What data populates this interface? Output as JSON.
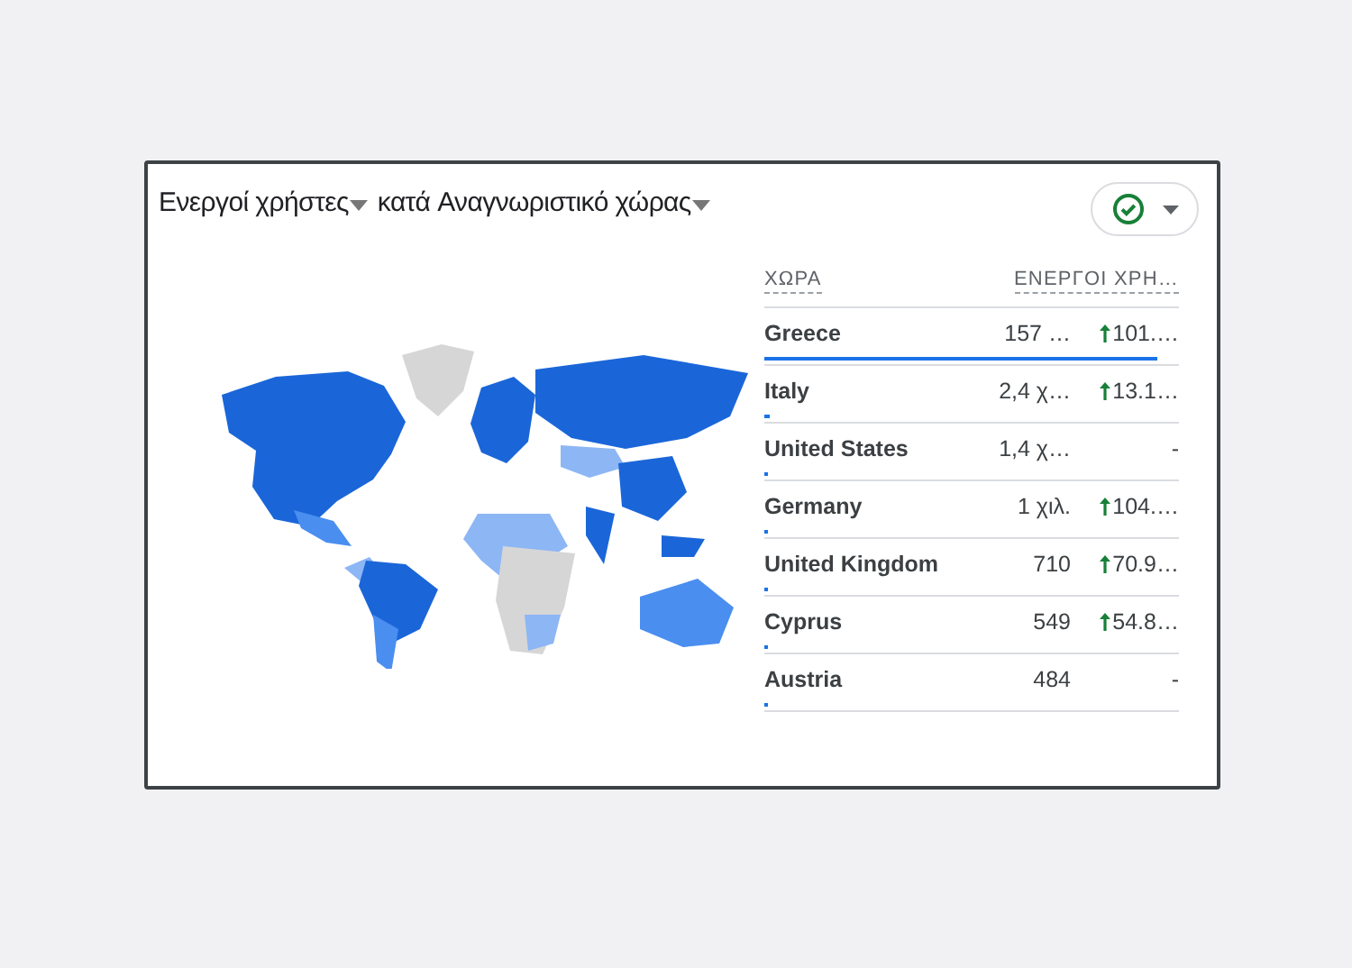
{
  "title": {
    "metric": "Ενεργοί χρήστες",
    "connector": "κατά",
    "dimension": "Αναγνωριστικό χώρας"
  },
  "columns": [
    "ΧΩΡΑ",
    "ΕΝΕΡΓΟΙ ΧΡΗ…"
  ],
  "rows": [
    {
      "country": "Greece",
      "users": "157 …",
      "change": "101.…",
      "kind": "up",
      "level": 0.99
    },
    {
      "country": "Italy",
      "users": "2,4 χ…",
      "change": "13.1…",
      "kind": "up",
      "level": 0.015
    },
    {
      "country": "United States",
      "users": "1,4 χ…",
      "change": "-",
      "kind": "none",
      "level": 0.009
    },
    {
      "country": "Germany",
      "users": "1 χιλ.",
      "change": "104.…",
      "kind": "up",
      "level": 0.007
    },
    {
      "country": "United Kingdom",
      "users": "710",
      "change": "70.9…",
      "kind": "up",
      "level": 0.005
    },
    {
      "country": "Cyprus",
      "users": "549",
      "change": "54.8…",
      "kind": "up",
      "level": 0.004
    },
    {
      "country": "Austria",
      "users": "484",
      "change": "-",
      "kind": "none",
      "level": 0.003
    }
  ]
}
